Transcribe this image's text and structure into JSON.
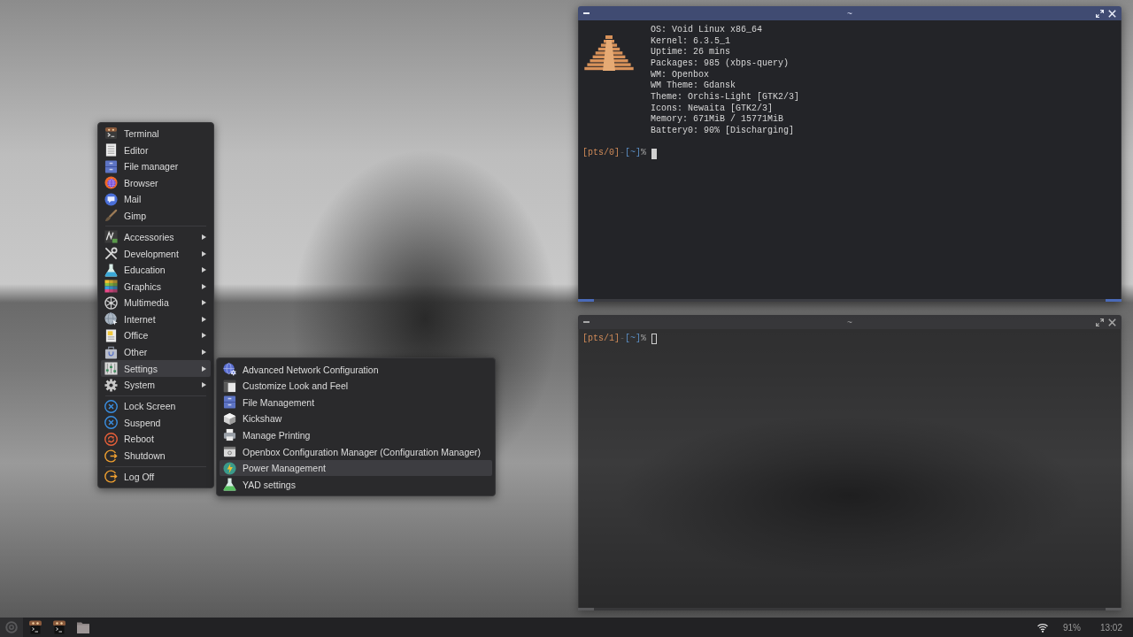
{
  "menu": {
    "sections": [
      {
        "items": [
          {
            "label": "Terminal",
            "submenu": false,
            "selected": false
          },
          {
            "label": "Editor",
            "submenu": false,
            "selected": false
          },
          {
            "label": "File manager",
            "submenu": false,
            "selected": false
          },
          {
            "label": "Browser",
            "submenu": false,
            "selected": false
          },
          {
            "label": "Mail",
            "submenu": false,
            "selected": false
          },
          {
            "label": "Gimp",
            "submenu": false,
            "selected": false
          }
        ]
      },
      {
        "items": [
          {
            "label": "Accessories",
            "submenu": true,
            "selected": false
          },
          {
            "label": "Development",
            "submenu": true,
            "selected": false
          },
          {
            "label": "Education",
            "submenu": true,
            "selected": false
          },
          {
            "label": "Graphics",
            "submenu": true,
            "selected": false
          },
          {
            "label": "Multimedia",
            "submenu": true,
            "selected": false
          },
          {
            "label": "Internet",
            "submenu": true,
            "selected": false
          },
          {
            "label": "Office",
            "submenu": true,
            "selected": false
          },
          {
            "label": "Other",
            "submenu": true,
            "selected": false
          },
          {
            "label": "Settings",
            "submenu": true,
            "selected": true
          },
          {
            "label": "System",
            "submenu": true,
            "selected": false
          }
        ]
      },
      {
        "items": [
          {
            "label": "Lock Screen",
            "submenu": false,
            "selected": false
          },
          {
            "label": "Suspend",
            "submenu": false,
            "selected": false
          },
          {
            "label": "Reboot",
            "submenu": false,
            "selected": false
          },
          {
            "label": "Shutdown",
            "submenu": false,
            "selected": false
          }
        ]
      },
      {
        "items": [
          {
            "label": "Log Off",
            "submenu": false,
            "selected": false
          }
        ]
      }
    ]
  },
  "submenu": {
    "items": [
      {
        "label": "Advanced Network Configuration",
        "selected": false
      },
      {
        "label": "Customize Look and Feel",
        "selected": false
      },
      {
        "label": "File Management",
        "selected": false
      },
      {
        "label": "Kickshaw",
        "selected": false
      },
      {
        "label": "Manage Printing",
        "selected": false
      },
      {
        "label": "Openbox Configuration Manager (Configuration Manager)",
        "selected": false
      },
      {
        "label": "Power Management",
        "selected": true
      },
      {
        "label": "YAD settings",
        "selected": false
      }
    ]
  },
  "terminals": [
    {
      "title": "~",
      "focused": true,
      "output": [
        "OS: Void Linux x86_64",
        "Kernel: 6.3.5_1",
        "Uptime: 26 mins",
        "Packages: 985 (xbps-query)",
        "WM: Openbox",
        "WM Theme: Gdansk",
        "Theme: Orchis-Light [GTK2/3]",
        "Icons: Newaita [GTK2/3]",
        "Memory: 671MiB / 15771MiB",
        "Battery0: 90% [Discharging]"
      ],
      "prompt": {
        "session": "[pts/0]",
        "separator": "-",
        "directory": "[~]",
        "symbol": "%"
      }
    },
    {
      "title": "~",
      "focused": false,
      "prompt": {
        "session": "[pts/1]",
        "separator": "-",
        "directory": "[~]",
        "symbol": "%"
      }
    }
  ],
  "tray": {
    "battery": "91%",
    "clock": "13:02"
  }
}
